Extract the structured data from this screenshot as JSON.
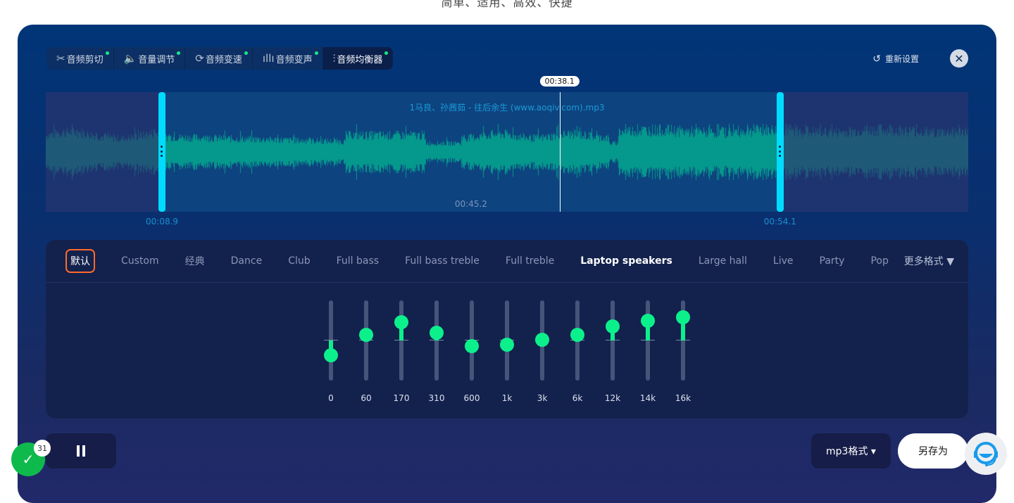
{
  "tagline": "简单、适用、高效、快捷",
  "toolbar": {
    "tools": [
      {
        "label": "音频剪切",
        "icon": "scissors-icon",
        "glyph": "✂",
        "active": false
      },
      {
        "label": "音量调节",
        "icon": "speaker-icon",
        "glyph": "🔈",
        "active": false
      },
      {
        "label": "音频变速",
        "icon": "speed-icon",
        "glyph": "⟳",
        "active": false
      },
      {
        "label": "音频变声",
        "icon": "voice-wave-icon",
        "glyph": "ıllı",
        "active": false
      },
      {
        "label": "音频均衡器",
        "icon": "equalizer-icon",
        "glyph": "⫶",
        "active": true
      }
    ],
    "reset_label": "重新设置",
    "reset_glyph": "↺",
    "close_glyph": "✕"
  },
  "waveform": {
    "filename": "1马良、孙茜茹 - 往后余生 (www.aoqiv.com).mp3",
    "start_time": "00:08.9",
    "end_time": "00:54.1",
    "selection_duration": "00:45.2",
    "playhead_time": "00:38.1",
    "start_fraction": 0.126,
    "end_fraction": 0.796,
    "playhead_fraction": 0.557,
    "colors": {
      "active": "#0cf08c",
      "inactive": "#1e5a78",
      "handle": "#00dcff"
    }
  },
  "equalizer": {
    "presets": [
      {
        "label": "默认",
        "state": "default"
      },
      {
        "label": "Custom"
      },
      {
        "label": "经典"
      },
      {
        "label": "Dance"
      },
      {
        "label": "Club"
      },
      {
        "label": "Full bass"
      },
      {
        "label": "Full bass treble"
      },
      {
        "label": "Full treble"
      },
      {
        "label": "Laptop speakers",
        "state": "selected"
      },
      {
        "label": "Large hall"
      },
      {
        "label": "Live"
      },
      {
        "label": "Party"
      },
      {
        "label": "Pop"
      }
    ],
    "more_label": "更多格式 ▼",
    "range_db": 12,
    "bands": [
      {
        "label": "0",
        "gain_db": -4.5
      },
      {
        "label": "60",
        "gain_db": 1.7
      },
      {
        "label": "170",
        "gain_db": 5.4
      },
      {
        "label": "310",
        "gain_db": 2.4
      },
      {
        "label": "600",
        "gain_db": -1.7
      },
      {
        "label": "1k",
        "gain_db": -1.3
      },
      {
        "label": "3k",
        "gain_db": 0.2
      },
      {
        "label": "6k",
        "gain_db": 1.7
      },
      {
        "label": "12k",
        "gain_db": 4.3
      },
      {
        "label": "14k",
        "gain_db": 5.8
      },
      {
        "label": "16k",
        "gain_db": 6.9
      }
    ]
  },
  "footer": {
    "format_label": "mp3格式 ▾",
    "save_as_label": "另存为",
    "task_count": "31",
    "check_glyph": "✓"
  }
}
